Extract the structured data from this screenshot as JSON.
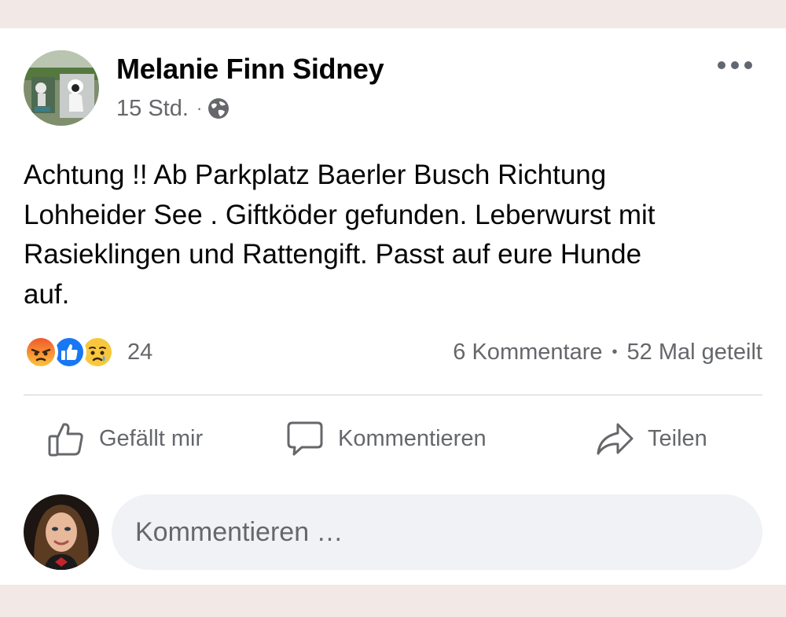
{
  "post": {
    "author": "Melanie Finn Sidney",
    "timestamp": "15 Std.",
    "separator": "·",
    "privacy_icon": "globe-icon",
    "more_icon": "more-options-icon",
    "text": "Achtung !! Ab Parkplatz Baerler Busch Richtung\nLohheider See . Giftköder gefunden. Leberwurst mit\nRasieklingen und Rattengift. Passt auf eure Hunde\nauf."
  },
  "reactions": {
    "types": [
      "angry",
      "like",
      "sad"
    ],
    "count": "24"
  },
  "stats": {
    "comments": "6 Kommentare",
    "separator": "•",
    "shares": "52 Mal geteilt"
  },
  "actions": {
    "like": "Gefällt mir",
    "comment": "Kommentieren",
    "share": "Teilen"
  },
  "comment_input": {
    "placeholder": "Kommentieren …",
    "value": ""
  },
  "colors": {
    "text_primary": "#050505",
    "text_secondary": "#65676b",
    "like_blue": "#1877f2",
    "input_bg": "#f0f2f5",
    "frame_bg": "#f2e9e6"
  }
}
